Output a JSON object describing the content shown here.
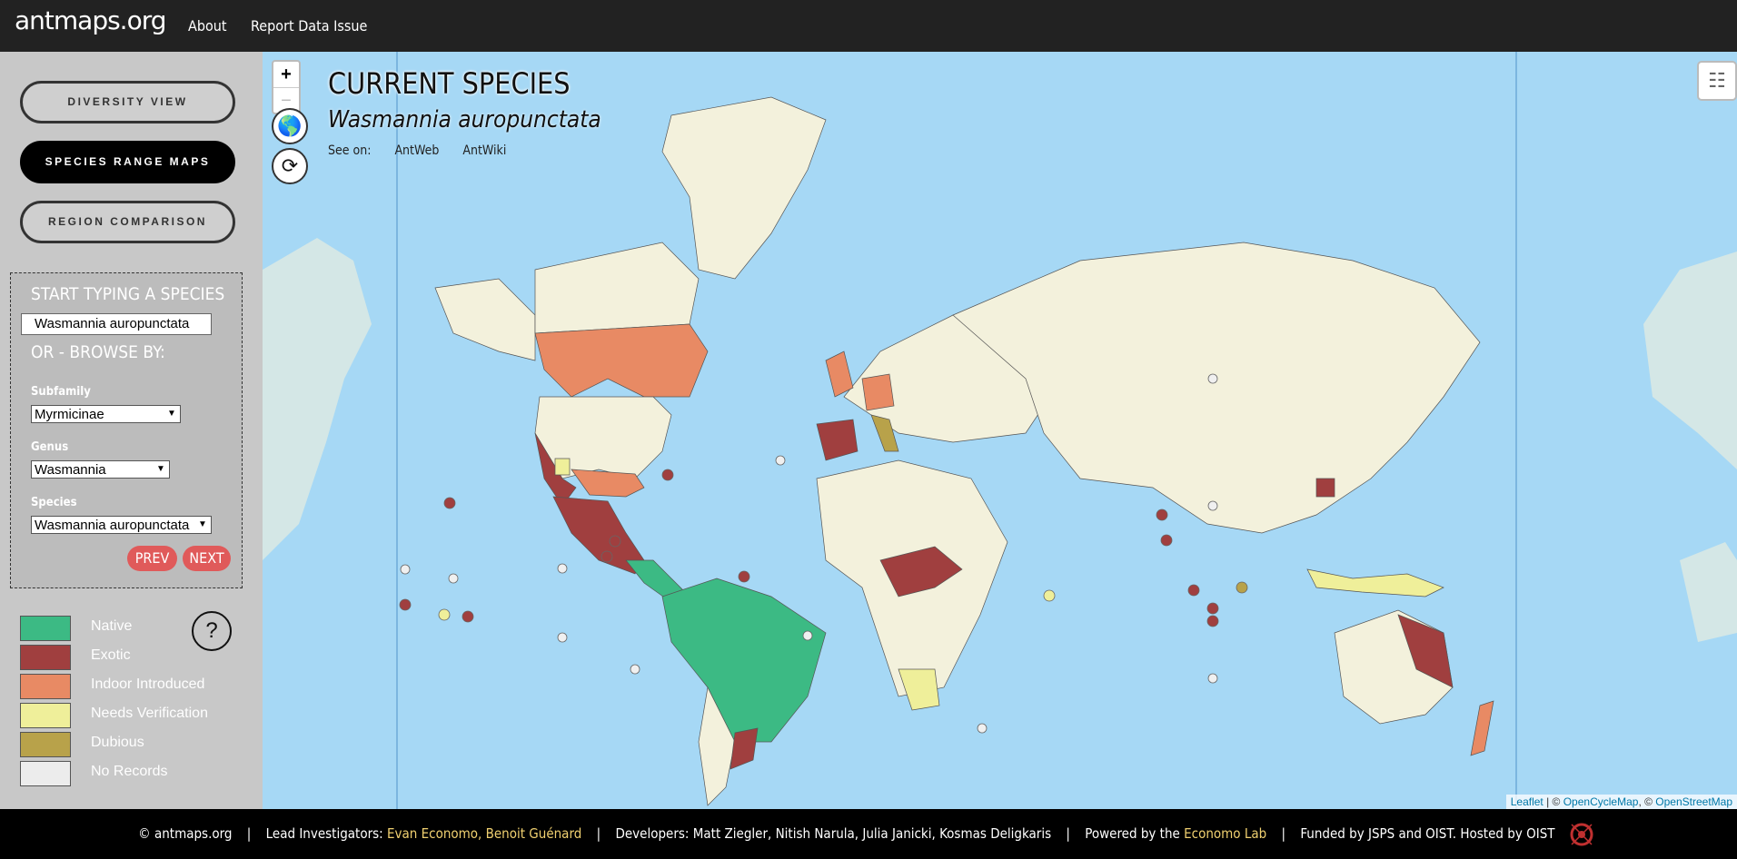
{
  "nav": {
    "brand": "antmaps.org",
    "links": [
      "About",
      "Report Data Issue"
    ]
  },
  "sidebar": {
    "views": [
      {
        "label": "DIVERSITY VIEW",
        "active": false
      },
      {
        "label": "SPECIES RANGE MAPS",
        "active": true
      },
      {
        "label": "REGION COMPARISON",
        "active": false
      }
    ],
    "search_title": "START TYPING A SPECIES",
    "search_value": "Wasmannia auropunctata",
    "browse_title": "OR - BROWSE BY:",
    "subfamily_label": "Subfamily",
    "subfamily_value": "Myrmicinae",
    "genus_label": "Genus",
    "genus_value": "Wasmannia",
    "species_label": "Species",
    "species_value": "Wasmannia auropunctata",
    "prev_label": "PREV",
    "next_label": "NEXT",
    "help_label": "?",
    "legend": [
      {
        "label": "Native",
        "color": "#3cba84"
      },
      {
        "label": "Exotic",
        "color": "#a03f3f"
      },
      {
        "label": "Indoor Introduced",
        "color": "#e88a64"
      },
      {
        "label": "Needs Verification",
        "color": "#efef9a"
      },
      {
        "label": "Dubious",
        "color": "#b8a24a"
      },
      {
        "label": "No Records",
        "color": "#ececec"
      }
    ]
  },
  "map": {
    "title": "CURRENT SPECIES",
    "species": "Wasmannia auropunctata",
    "see_on_label": "See on:",
    "see_on_links": [
      "AntWeb",
      "AntWiki"
    ],
    "zoom_in": "+",
    "zoom_out": "−",
    "icons": [
      "globe-icon",
      "refresh-icon",
      "layers-icon"
    ],
    "attribution": {
      "leaflet": "Leaflet",
      "sep1": " | © ",
      "opencyclemap": "OpenCycleMap",
      "sep2": ", © ",
      "openstreetmap": "OpenStreetMap"
    }
  },
  "footer": {
    "copyright": "© antmaps.org",
    "lead_label": "Lead Investigators:",
    "lead_names": "Evan Economo, Benoit Guénard",
    "dev_label": "Developers:",
    "dev_names": "Matt Ziegler, Nitish Narula, Julia Janicki, Kosmas Deligkaris",
    "powered_label": "Powered by the",
    "powered_name": "Economo Lab",
    "funded": "Funded by JSPS and OIST. Hosted by OIST"
  }
}
